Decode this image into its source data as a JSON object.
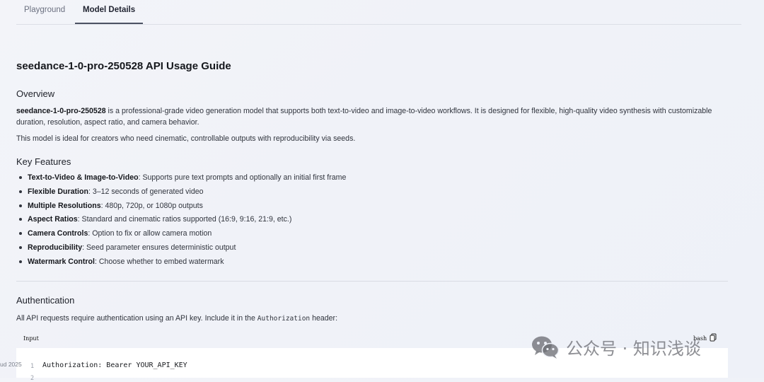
{
  "tabs": [
    {
      "label": "Playground",
      "active": false
    },
    {
      "label": "Model Details",
      "active": true
    }
  ],
  "page_title": "seedance-1-0-pro-250528 API Usage Guide",
  "overview": {
    "heading": "Overview",
    "model_name": "seedance-1-0-pro-250528",
    "para1_rest": " is a professional-grade video generation model that supports both text-to-video and image-to-video workflows. It is designed for flexible, high-quality video synthesis with customizable duration, resolution, aspect ratio, and camera behavior.",
    "para2": "This model is ideal for creators who need cinematic, controllable outputs with reproducibility via seeds."
  },
  "key_features": {
    "heading": "Key Features",
    "items": [
      {
        "name": "Text-to-Video & Image-to-Video",
        "desc": ": Supports pure text prompts and optionally an initial first frame"
      },
      {
        "name": "Flexible Duration",
        "desc": ": 3–12 seconds of generated video"
      },
      {
        "name": "Multiple Resolutions",
        "desc": ": 480p, 720p, or 1080p outputs"
      },
      {
        "name": "Aspect Ratios",
        "desc": ": Standard and cinematic ratios supported (16:9, 9:16, 21:9, etc.)"
      },
      {
        "name": "Camera Controls",
        "desc": ": Option to fix or allow camera motion"
      },
      {
        "name": "Reproducibility",
        "desc": ": Seed parameter ensures deterministic output"
      },
      {
        "name": "Watermark Control",
        "desc": ": Choose whether to embed watermark"
      }
    ]
  },
  "authentication": {
    "heading": "Authentication",
    "text_before": "All API requests require authentication using an API key. Include it in the ",
    "code": "Authorization",
    "text_after": " header:"
  },
  "code_block": {
    "lang_left": "Input",
    "lang_right": "bash",
    "lines": [
      {
        "num": "1",
        "text": "Authorization: Bearer YOUR_API_KEY"
      },
      {
        "num": "2",
        "text": ""
      }
    ]
  },
  "footer_left": "ud 2025",
  "watermark": {
    "text": "公众号 · 知识浅谈",
    "icon": "wechat-logo-icon"
  }
}
